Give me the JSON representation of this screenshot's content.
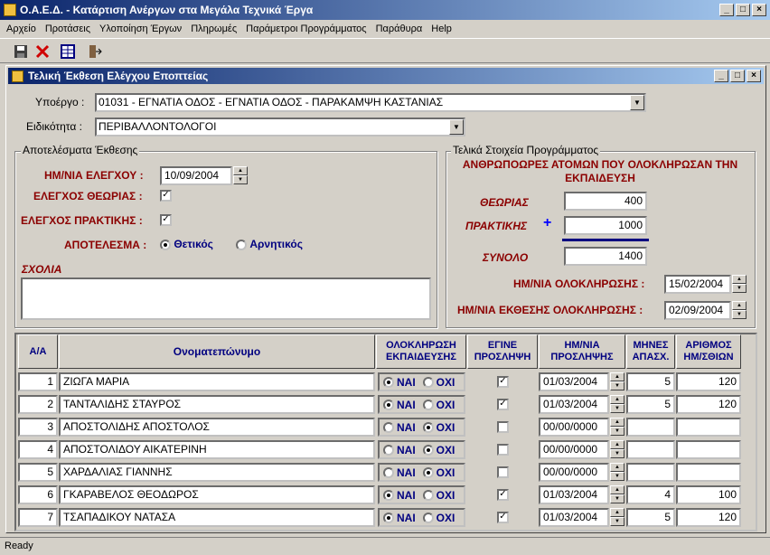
{
  "app": {
    "title": "Ο.Α.Ε.Δ. - Κατάρτιση Ανέργων στα Μεγάλα Τεχνικά Έργα"
  },
  "menu": [
    "Αρχείο",
    "Προτάσεις",
    "Υλοποίηση Έργων",
    "Πληρωμές",
    "Παράμετροι Προγράμματος",
    "Παράθυρα",
    "Help"
  ],
  "toolbar_icons": [
    "save-icon",
    "delete-icon",
    "grid-icon",
    "exit-icon"
  ],
  "child": {
    "title": "Τελική Έκθεση Ελέγχου Εποπτείας"
  },
  "form": {
    "subproject_label": "Υποέργο :",
    "subproject_value": "01031 - ΕΓΝΑΤΙΑ ΟΔΟΣ - ΕΓΝΑΤΙΑ ΟΔΟΣ - ΠΑΡΑΚΑΜΨΗ ΚΑΣΤΑΝΙΑΣ",
    "specialty_label": "Ειδικότητα :",
    "specialty_value": "ΠΕΡΙΒΑΛΛΟΝΤΟΛΟΓΟΙ"
  },
  "results": {
    "group_title": "Αποτελέσματα Έκθεσης",
    "check_date_label": "ΗΜ/ΝΙΑ ΕΛΕΓΧΟΥ :",
    "check_date": "10/09/2004",
    "theory_label": "ΕΛΕΓΧΟΣ ΘΕΩΡΙΑΣ :",
    "practice_label": "ΕΛΕΓΧΟΣ ΠΡΑΚΤΙΚΗΣ :",
    "result_label": "ΑΠΟΤΕΛΕΣΜΑ :",
    "positive": "Θετικός",
    "negative": "Αρνητικός",
    "comments_label": "ΣΧΟΛΙΑ",
    "comments": ""
  },
  "program": {
    "group_title": "Τελικά Στοιχεία Προγράμματος",
    "heading": "ΑΝΘΡΩΠΟΩΡΕΣ ΑΤΟΜΩΝ ΠΟΥ ΟΛΟΚΛΗΡΩΣΑΝ ΤΗΝ ΕΚΠΑΙΔΕΥΣΗ",
    "theory_label": "ΘΕΩΡΙΑΣ",
    "theory": "400",
    "practice_label": "ΠΡΑΚΤΙΚΗΣ",
    "plus": "+",
    "practice": "1000",
    "total_label": "ΣΥΝΟΛΟ",
    "total": "1400",
    "end_date_label": "ΗΜ/ΝΙΑ ΟΛΟΚΛΗΡΩΣΗΣ :",
    "end_date": "15/02/2004",
    "report_date_label": "ΗΜ/ΝΙΑ ΕΚΘΕΣΗΣ ΟΛΟΚΛΗΡΩΣΗΣ :",
    "report_date": "02/09/2004"
  },
  "table": {
    "headers": [
      "Α/Α",
      "Ονοματεπώνυμο",
      "ΟΛΟΚΛΗΡΩΣΗ ΕΚΠΑΙΔΕΥΣΗΣ",
      "ΕΓΙΝΕ ΠΡΟΣΛΗΨΗ",
      "ΗΜ/ΝΙΑ ΠΡΟΣΛΗΨΗΣ",
      "ΜΗΝΕΣ ΑΠΑΣΧ.",
      "ΑΡΙΘΜΟΣ ΗΜ/ΣΘΙΩΝ"
    ],
    "yes": "ΝΑΙ",
    "no": "ΟΧΙ",
    "rows": [
      {
        "n": "1",
        "name": "ΖΙΩΓΑ  ΜΑΡΙΑ",
        "done": true,
        "hired": true,
        "date": "01/03/2004",
        "months": "5",
        "days": "120"
      },
      {
        "n": "2",
        "name": "ΤΑΝΤΑΛΙΔΗΣ ΣΤΑΥΡΟΣ",
        "done": true,
        "hired": true,
        "date": "01/03/2004",
        "months": "5",
        "days": "120"
      },
      {
        "n": "3",
        "name": "ΑΠΟΣΤΟΛΙΔΗΣ ΑΠΟΣΤΟΛΟΣ",
        "done": false,
        "hired": false,
        "date": "00/00/0000",
        "months": "",
        "days": ""
      },
      {
        "n": "4",
        "name": "ΑΠΟΣΤΟΛΙΔΟΥ ΑΙΚΑΤΕΡΙΝΗ",
        "done": false,
        "hired": false,
        "date": "00/00/0000",
        "months": "",
        "days": ""
      },
      {
        "n": "5",
        "name": "ΧΑΡΔΑΛΙΑΣ ΓΙΑΝΝΗΣ",
        "done": false,
        "hired": false,
        "date": "00/00/0000",
        "months": "",
        "days": ""
      },
      {
        "n": "6",
        "name": "ΓΚΑΡΑΒΕΛΟΣ ΘΕΟΔΩΡΟΣ",
        "done": true,
        "hired": true,
        "date": "01/03/2004",
        "months": "4",
        "days": "100"
      },
      {
        "n": "7",
        "name": "ΤΣΑΠΑΔΙΚΟΥ ΝΑΤΑΣΑ",
        "done": true,
        "hired": true,
        "date": "01/03/2004",
        "months": "5",
        "days": "120"
      }
    ]
  },
  "status": {
    "text": "Ready"
  }
}
